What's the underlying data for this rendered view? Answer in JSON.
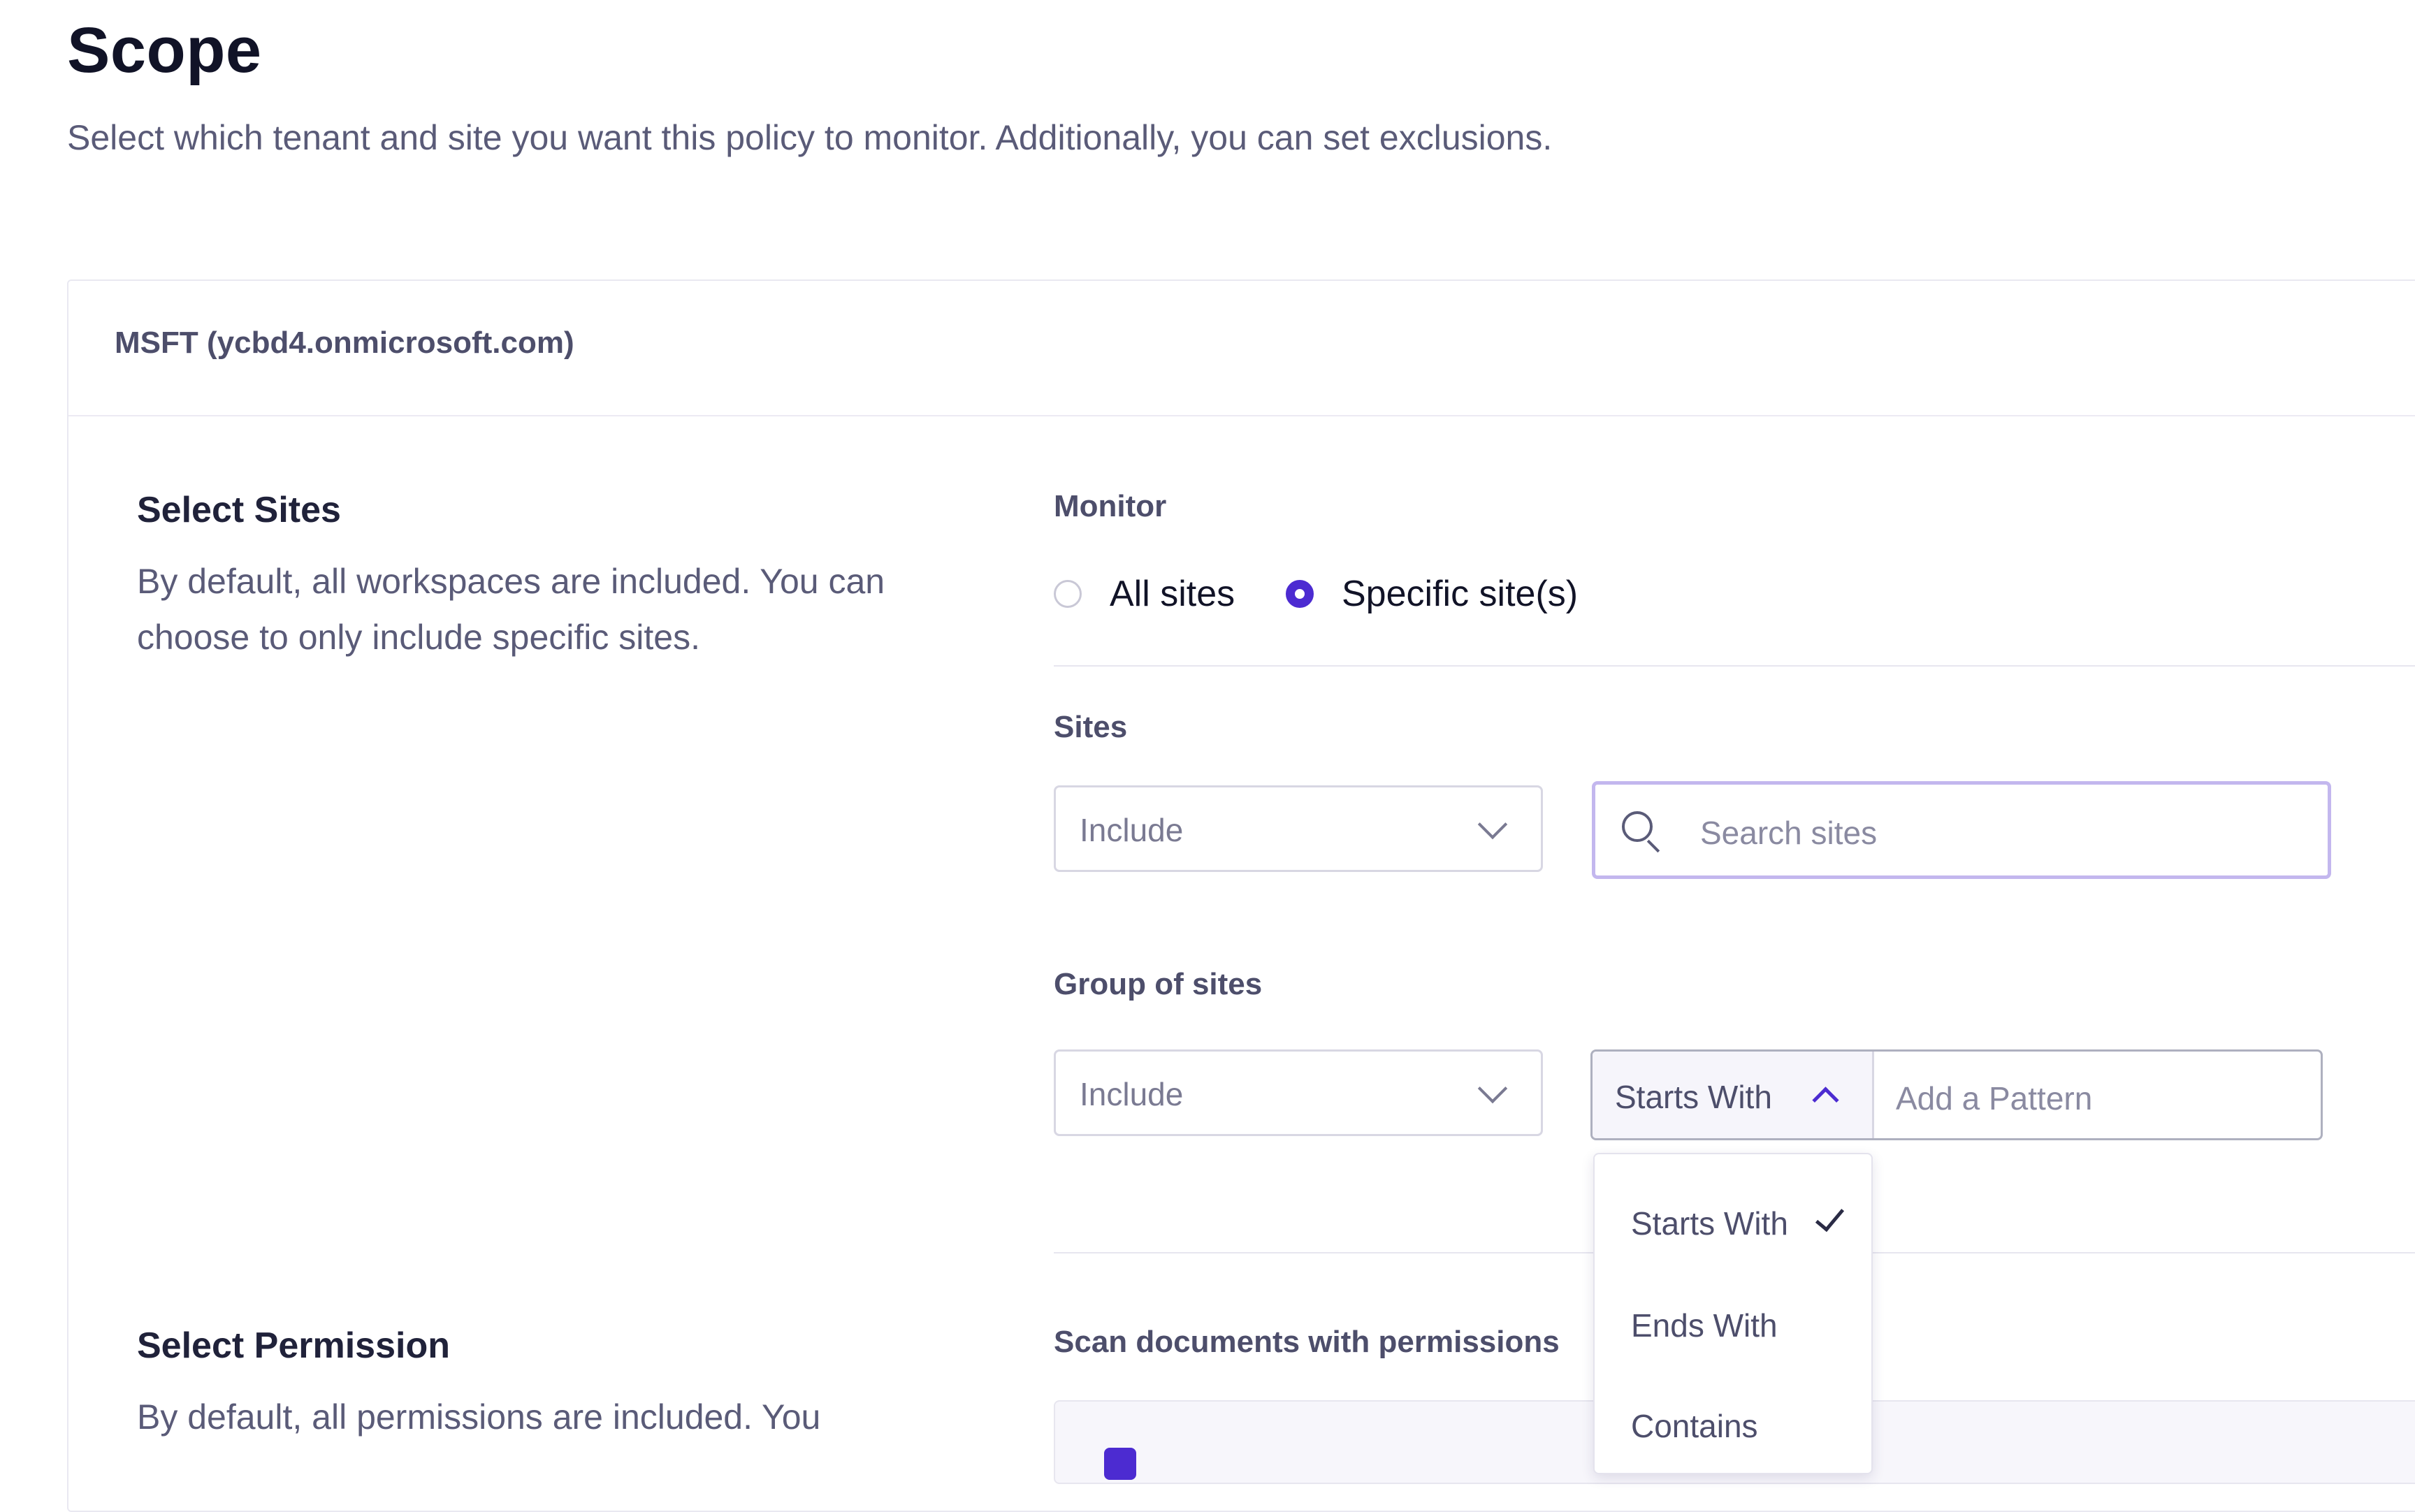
{
  "page": {
    "title": "Scope",
    "subtitle": "Select which tenant and site you want this policy to monitor. Additionally, you can set exclusions."
  },
  "tenant": {
    "name": "MSFT (ycbd4.onmicrosoft.com)"
  },
  "select_sites": {
    "title": "Select Sites",
    "description": "By default, all workspaces are included. You can choose to only include specific sites.",
    "monitor": {
      "label": "Monitor",
      "options": [
        {
          "label": "All sites",
          "selected": false
        },
        {
          "label": "Specific site(s)",
          "selected": true
        }
      ]
    },
    "sites": {
      "label": "Sites",
      "mode": "Include",
      "search_placeholder": "Search sites"
    },
    "group_of_sites": {
      "label": "Group of sites",
      "mode": "Include",
      "operator": "Starts With",
      "pattern_placeholder": "Add a Pattern",
      "operator_menu": [
        {
          "label": "Starts With",
          "checked": true
        },
        {
          "label": "Ends With",
          "checked": false
        },
        {
          "label": "Contains",
          "checked": false
        }
      ]
    }
  },
  "select_permission": {
    "title": "Select Permission",
    "description": "By default, all permissions are included. You",
    "scan_label": "Scan documents with permissions"
  },
  "colors": {
    "accent": "#4c2bd1",
    "search_focus_border": "#c3b7ee",
    "text_primary": "#111327",
    "text_secondary": "#5a5b78"
  },
  "icons": {
    "search": "search-icon",
    "select_chevron": "chevron-down-icon",
    "operator_chevron": "chevron-up-icon",
    "selected_check": "check-icon"
  }
}
